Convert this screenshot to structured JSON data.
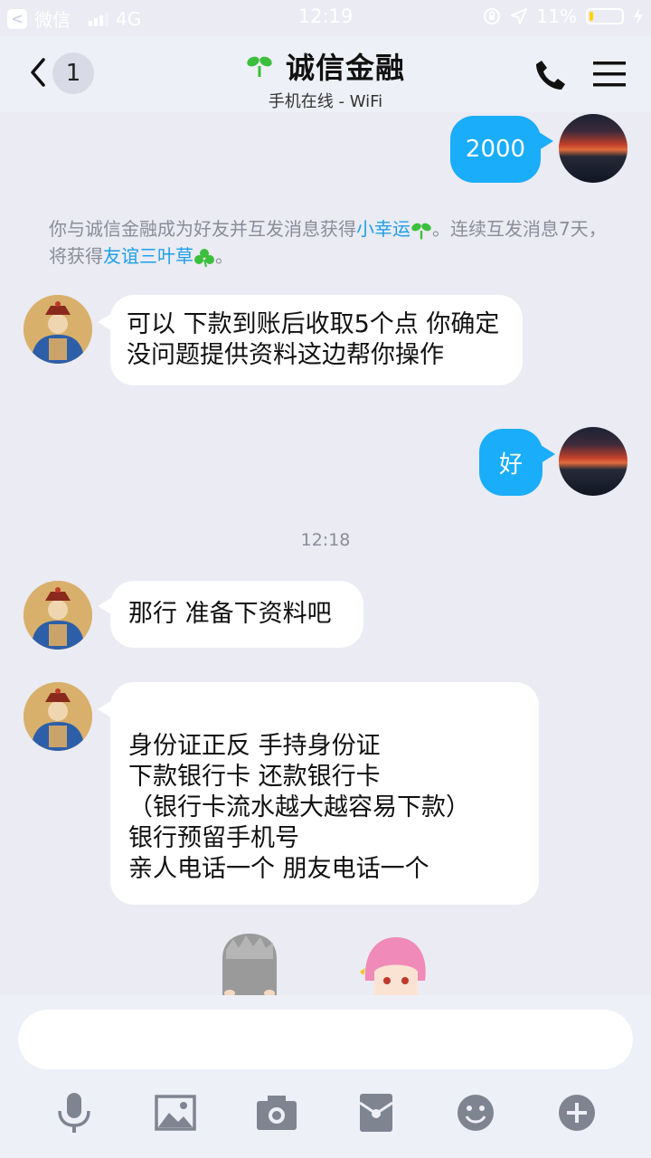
{
  "status_bar": {
    "back_app": "微信",
    "network": "4G",
    "time": "12:19",
    "battery_percent": "11%",
    "battery_level": 0.11
  },
  "header": {
    "unread_count": "1",
    "title": "诚信金融",
    "subtitle": "手机在线 - WiFi"
  },
  "messages": [
    {
      "side": "out",
      "text": "2000"
    },
    {
      "side": "system",
      "text_a": "你与诚信金融成为好友并互发消息获得",
      "link_a": "小幸运",
      "text_b": "。连续互发消息7天，将获得",
      "link_b": "友谊三叶草",
      "text_c": "。"
    },
    {
      "side": "in",
      "text": "可以 下款到账后收取5个点 你确定没问题提供资料这边帮你操作"
    },
    {
      "side": "out",
      "text": "好"
    },
    {
      "side": "time",
      "text": "12:18"
    },
    {
      "side": "in",
      "text": "那行 准备下资料吧"
    },
    {
      "side": "in",
      "lines": [
        "身份证正反  手持身份证",
        "下款银行卡 还款银行卡",
        "（银行卡流水越大越容易下款）",
        "银行预留手机号",
        "亲人电话一个 朋友电话一个"
      ]
    }
  ],
  "input": {
    "placeholder": ""
  },
  "toolbar": [
    "mic-icon",
    "image-icon",
    "camera-icon",
    "red-packet-icon",
    "emoji-icon",
    "plus-icon"
  ],
  "colors": {
    "background": "#eaebf3",
    "outgoing_bubble": "#1aadf9",
    "link": "#1e9fe8"
  }
}
